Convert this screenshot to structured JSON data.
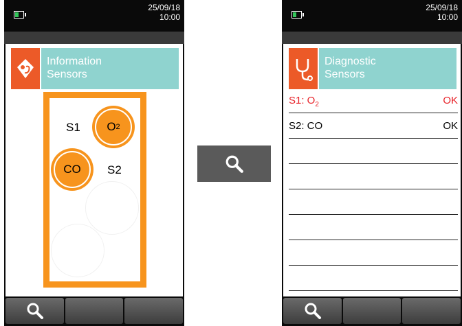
{
  "left": {
    "date": "25/09/18",
    "time": "10:00",
    "header_line1": "Information",
    "header_line2": "Sensors",
    "s1_label": "S1",
    "s1_gas": "O",
    "s1_gas_sub": "2",
    "s2_label": "S2",
    "s2_gas": "CO"
  },
  "middle": {
    "icon": "search-icon"
  },
  "right": {
    "date": "25/09/18",
    "time": "10:00",
    "header_line1": "Diagnostic",
    "header_line2": "Sensors",
    "rows": [
      {
        "name": "S1: O",
        "sub": "2",
        "status": "OK",
        "alert": true
      },
      {
        "name": "S2: CO",
        "sub": "",
        "status": "OK",
        "alert": false
      }
    ]
  },
  "colors": {
    "accent_orange": "#f7941d",
    "header_teal": "#8fd3cf",
    "icon_orange": "#ec5a28",
    "alert_red": "#e8232a"
  }
}
